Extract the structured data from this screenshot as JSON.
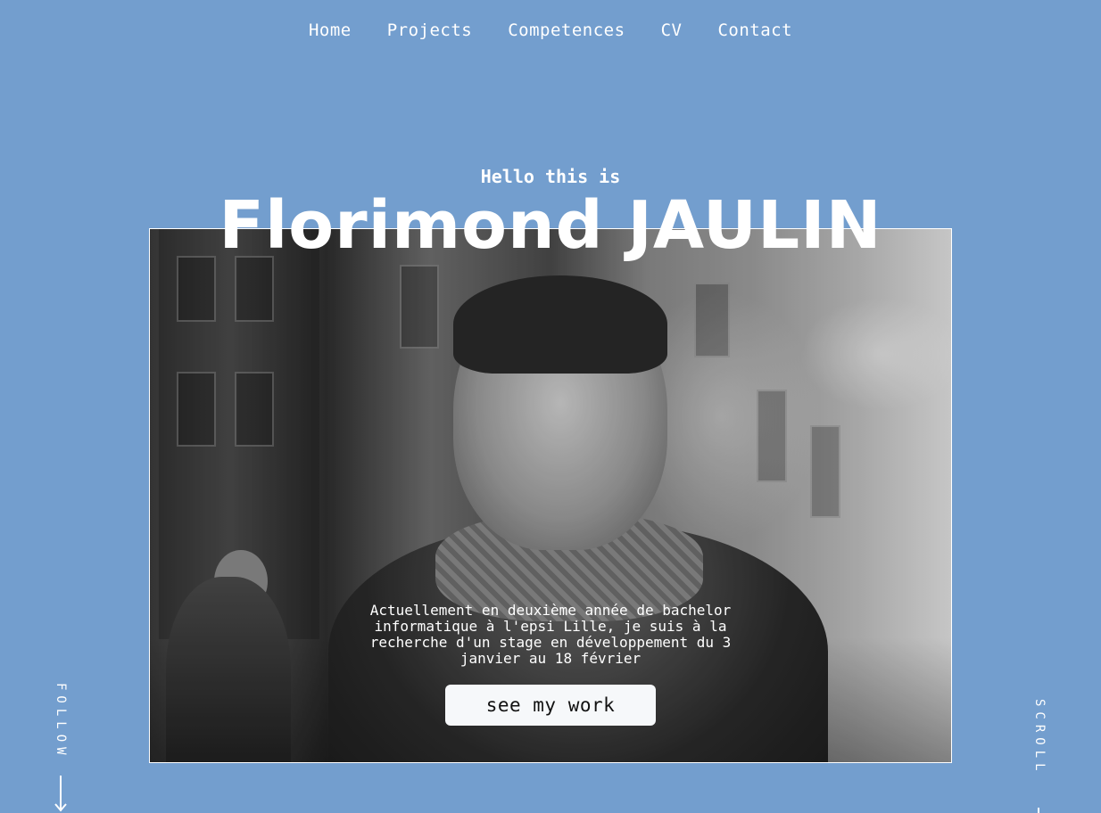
{
  "nav": {
    "items": [
      "Home",
      "Projects",
      "Competences",
      "CV",
      "Contact"
    ]
  },
  "hero": {
    "greeting": "Hello this is",
    "name": "Florimond JAULIN",
    "intro_lines": [
      "Actuellement en deuxième année de bachelor",
      "informatique à l'epsi Lille, je suis à la",
      "recherche d'un stage en développement du 3",
      "janvier au 18 février"
    ],
    "cta_label": "see my work"
  },
  "side": {
    "follow_label": "FOLLOW",
    "scroll_label": "SCROLL"
  },
  "colors": {
    "background": "#739ece",
    "text": "#ffffff",
    "button_bg": "#f6f8fa"
  },
  "icons": {
    "follow_arrow": "arrow-down-icon"
  }
}
